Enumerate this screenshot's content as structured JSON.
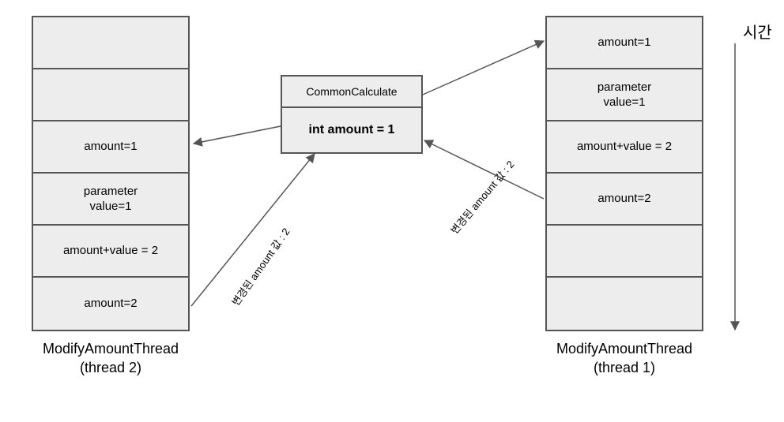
{
  "left_column": {
    "rows": [
      "",
      "",
      "amount=1",
      "parameter\nvalue=1",
      "amount+value = 2",
      "amount=2"
    ],
    "caption": "ModifyAmountThread\n(thread 2)"
  },
  "right_column": {
    "rows": [
      "amount=1",
      "parameter\nvalue=1",
      "amount+value = 2",
      "amount=2",
      "",
      ""
    ],
    "caption": "ModifyAmountThread\n(thread 1)"
  },
  "center": {
    "title": "CommonCalculate",
    "body": "int amount = 1"
  },
  "labels": {
    "time": "시간",
    "left_arrow_label": "변경된 amount 값 : 2",
    "right_arrow_label": "변경된 amount 값 : 2"
  }
}
